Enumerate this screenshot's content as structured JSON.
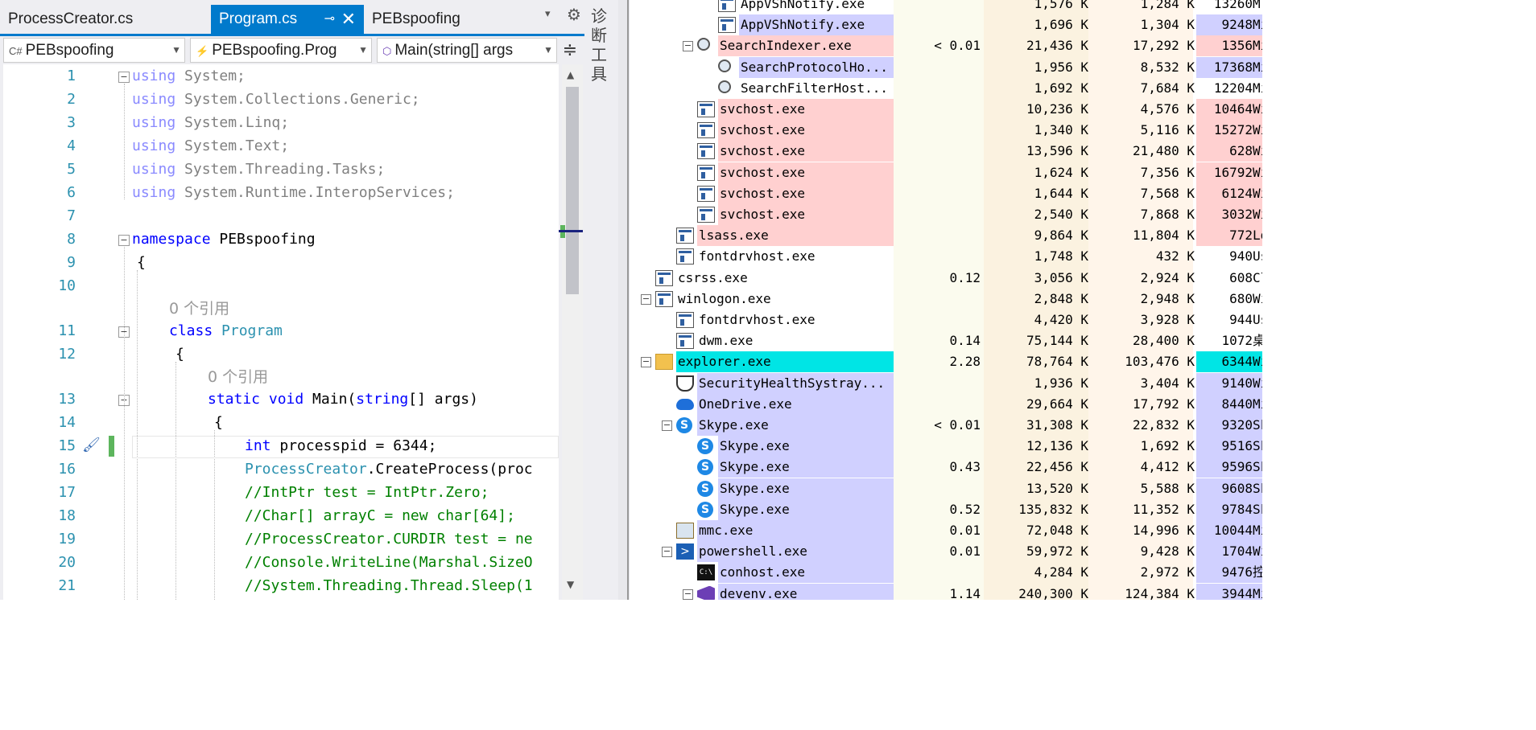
{
  "editor": {
    "tabs": [
      {
        "label": "ProcessCreator.cs",
        "active": false
      },
      {
        "label": "Program.cs",
        "active": true,
        "pin": "⊸",
        "close": "✕"
      },
      {
        "label": "PEBspoofing",
        "active": false
      }
    ],
    "tab_overflow_icon": "▾",
    "tab_settings_icon": "⚙",
    "nav": {
      "project": "PEBspoofing",
      "project_icon": "C#",
      "class": "PEBspoofing.Prog",
      "member": "Main(string[] args"
    },
    "split_icon": "≑",
    "codelens": "0 个引用",
    "lines": [
      {
        "n": "1"
      },
      {
        "n": "2"
      },
      {
        "n": "3"
      },
      {
        "n": "4"
      },
      {
        "n": "5"
      },
      {
        "n": "6"
      },
      {
        "n": "7"
      },
      {
        "n": "8"
      },
      {
        "n": "9"
      },
      {
        "n": "10"
      },
      {
        "n": "11"
      },
      {
        "n": "12"
      },
      {
        "n": "13"
      },
      {
        "n": "14"
      },
      {
        "n": "15"
      },
      {
        "n": "16"
      },
      {
        "n": "17"
      },
      {
        "n": "18"
      },
      {
        "n": "19"
      },
      {
        "n": "20"
      },
      {
        "n": "21"
      }
    ],
    "code": {
      "l1": "System;",
      "l2": "System.Collections.Generic;",
      "l3": "System.Linq;",
      "l4": "System.Text;",
      "l5": "System.Threading.Tasks;",
      "l6": "System.Runtime.InteropServices;",
      "l8_kw": "namespace",
      "l8_name": " PEBspoofing",
      "l9": "{",
      "l11_kw": "class",
      "l11_name": " Program",
      "l12": "{",
      "l13_kw": "static void",
      "l13_rest": " Main(",
      "l13_kw2": "string",
      "l13_end": "[] args)",
      "l14": "{",
      "l15_kw": "int",
      "l15_rest": " processpid = 6344;",
      "l16_type": "ProcessCreator",
      "l16_rest": ".CreateProcess(proc",
      "l17": "//IntPtr test = IntPtr.Zero;",
      "l18": "//Char[] arrayC = new char[64];",
      "l19": "//ProcessCreator.CURDIR test = ne",
      "l20": "//Console.WriteLine(Marshal.SizeO",
      "l21": "//System.Threading.Thread.Sleep(1",
      "using_kw": "using"
    }
  },
  "toolstrip": {
    "label": "诊断工具"
  },
  "processes": [
    {
      "name": "AppVShNotify.exe",
      "cpu": "",
      "private": "1,576 K",
      "working": "1,284 K",
      "pid": "13260",
      "desc": "M",
      "indent": 3,
      "icon": "window",
      "color": "#ffffff"
    },
    {
      "name": "AppVShNotify.exe",
      "cpu": "",
      "private": "1,696 K",
      "working": "1,304 K",
      "pid": "9248",
      "desc": "Mi",
      "indent": 3,
      "icon": "window",
      "color": "#d0d0ff"
    },
    {
      "name": "SearchIndexer.exe",
      "cpu": "< 0.01",
      "private": "21,436 K",
      "working": "17,292 K",
      "pid": "1356",
      "desc": "Mi",
      "indent": 2,
      "icon": "search",
      "color": "#ffd0d0",
      "expand": "−"
    },
    {
      "name": "SearchProtocolHo...",
      "cpu": "",
      "private": "1,956 K",
      "working": "8,532 K",
      "pid": "17368",
      "desc": "Mi",
      "indent": 3,
      "icon": "search",
      "color": "#d0d0ff"
    },
    {
      "name": "SearchFilterHost...",
      "cpu": "",
      "private": "1,692 K",
      "working": "7,684 K",
      "pid": "12204",
      "desc": "Mi",
      "indent": 3,
      "icon": "search",
      "color": "#ffffff"
    },
    {
      "name": "svchost.exe",
      "cpu": "",
      "private": "10,236 K",
      "working": "4,576 K",
      "pid": "10464",
      "desc": "Wi",
      "indent": 2,
      "icon": "window",
      "color": "#ffd0d0"
    },
    {
      "name": "svchost.exe",
      "cpu": "",
      "private": "1,340 K",
      "working": "5,116 K",
      "pid": "15272",
      "desc": "Wi",
      "indent": 2,
      "icon": "window",
      "color": "#ffd0d0"
    },
    {
      "name": "svchost.exe",
      "cpu": "",
      "private": "13,596 K",
      "working": "21,480 K",
      "pid": "628",
      "desc": "Wi",
      "indent": 2,
      "icon": "window",
      "color": "#ffd0d0"
    },
    {
      "name": "svchost.exe",
      "cpu": "",
      "private": "1,624 K",
      "working": "7,356 K",
      "pid": "16792",
      "desc": "Wi",
      "indent": 2,
      "icon": "window",
      "color": "#ffd0d0"
    },
    {
      "name": "svchost.exe",
      "cpu": "",
      "private": "1,644 K",
      "working": "7,568 K",
      "pid": "6124",
      "desc": "Wi",
      "indent": 2,
      "icon": "window",
      "color": "#ffd0d0"
    },
    {
      "name": "svchost.exe",
      "cpu": "",
      "private": "2,540 K",
      "working": "7,868 K",
      "pid": "3032",
      "desc": "Wi",
      "indent": 2,
      "icon": "window",
      "color": "#ffd0d0"
    },
    {
      "name": "lsass.exe",
      "cpu": "",
      "private": "9,864 K",
      "working": "11,804 K",
      "pid": "772",
      "desc": "Lo",
      "indent": 1,
      "icon": "window",
      "color": "#ffd0d0"
    },
    {
      "name": "fontdrvhost.exe",
      "cpu": "",
      "private": "1,748 K",
      "working": "432 K",
      "pid": "940",
      "desc": "Us",
      "indent": 1,
      "icon": "window",
      "color": "#ffffff"
    },
    {
      "name": "csrss.exe",
      "cpu": "0.12",
      "private": "3,056 K",
      "working": "2,924 K",
      "pid": "608",
      "desc": "Cl",
      "indent": 0,
      "icon": "window",
      "color": "#ffffff"
    },
    {
      "name": "winlogon.exe",
      "cpu": "",
      "private": "2,848 K",
      "working": "2,948 K",
      "pid": "680",
      "desc": "Wi",
      "indent": 0,
      "icon": "window",
      "color": "#ffffff",
      "expand": "−"
    },
    {
      "name": "fontdrvhost.exe",
      "cpu": "",
      "private": "4,420 K",
      "working": "3,928 K",
      "pid": "944",
      "desc": "Us",
      "indent": 1,
      "icon": "window",
      "color": "#ffffff"
    },
    {
      "name": "dwm.exe",
      "cpu": "0.14",
      "private": "75,144 K",
      "working": "28,400 K",
      "pid": "1072",
      "desc": "桌",
      "indent": 1,
      "icon": "window",
      "color": "#ffffff"
    },
    {
      "name": "explorer.exe",
      "cpu": "2.28",
      "private": "78,764 K",
      "working": "103,476 K",
      "pid": "6344",
      "desc": "Wi",
      "indent": 0,
      "icon": "folder",
      "color": "#00e5e5",
      "expand": "−"
    },
    {
      "name": "SecurityHealthSystray...",
      "cpu": "",
      "private": "1,936 K",
      "working": "3,404 K",
      "pid": "9140",
      "desc": "Wi",
      "indent": 1,
      "icon": "shield",
      "color": "#d0d0ff"
    },
    {
      "name": "OneDrive.exe",
      "cpu": "",
      "private": "29,664 K",
      "working": "17,792 K",
      "pid": "8440",
      "desc": "Mi",
      "indent": 1,
      "icon": "onedrive",
      "color": "#d0d0ff"
    },
    {
      "name": "Skype.exe",
      "cpu": "< 0.01",
      "private": "31,308 K",
      "working": "22,832 K",
      "pid": "9320",
      "desc": "Sk",
      "indent": 1,
      "icon": "skype",
      "color": "#d0d0ff",
      "expand": "−"
    },
    {
      "name": "Skype.exe",
      "cpu": "",
      "private": "12,136 K",
      "working": "1,692 K",
      "pid": "9516",
      "desc": "Sk",
      "indent": 2,
      "icon": "skype",
      "color": "#d0d0ff"
    },
    {
      "name": "Skype.exe",
      "cpu": "0.43",
      "private": "22,456 K",
      "working": "4,412 K",
      "pid": "9596",
      "desc": "Sk",
      "indent": 2,
      "icon": "skype",
      "color": "#d0d0ff"
    },
    {
      "name": "Skype.exe",
      "cpu": "",
      "private": "13,520 K",
      "working": "5,588 K",
      "pid": "9608",
      "desc": "Sk",
      "indent": 2,
      "icon": "skype",
      "color": "#d0d0ff"
    },
    {
      "name": "Skype.exe",
      "cpu": "0.52",
      "private": "135,832 K",
      "working": "11,352 K",
      "pid": "9784",
      "desc": "Sk",
      "indent": 2,
      "icon": "skype",
      "color": "#d0d0ff"
    },
    {
      "name": "mmc.exe",
      "cpu": "0.01",
      "private": "72,048 K",
      "working": "14,996 K",
      "pid": "10044",
      "desc": "Mi",
      "indent": 1,
      "icon": "mmc",
      "color": "#d0d0ff"
    },
    {
      "name": "powershell.exe",
      "cpu": "0.01",
      "private": "59,972 K",
      "working": "9,428 K",
      "pid": "1704",
      "desc": "Wi",
      "indent": 1,
      "icon": "powershell",
      "color": "#d0d0ff",
      "expand": "−"
    },
    {
      "name": "conhost.exe",
      "cpu": "",
      "private": "4,284 K",
      "working": "2,972 K",
      "pid": "9476",
      "desc": "控",
      "indent": 2,
      "icon": "cmd",
      "color": "#d0d0ff"
    },
    {
      "name": "devenv.exe",
      "cpu": "1.14",
      "private": "240,300 K",
      "working": "124,384 K",
      "pid": "3944",
      "desc": "Mi",
      "indent": 2,
      "icon": "vs",
      "color": "#d0d0ff",
      "expand": "−"
    }
  ]
}
